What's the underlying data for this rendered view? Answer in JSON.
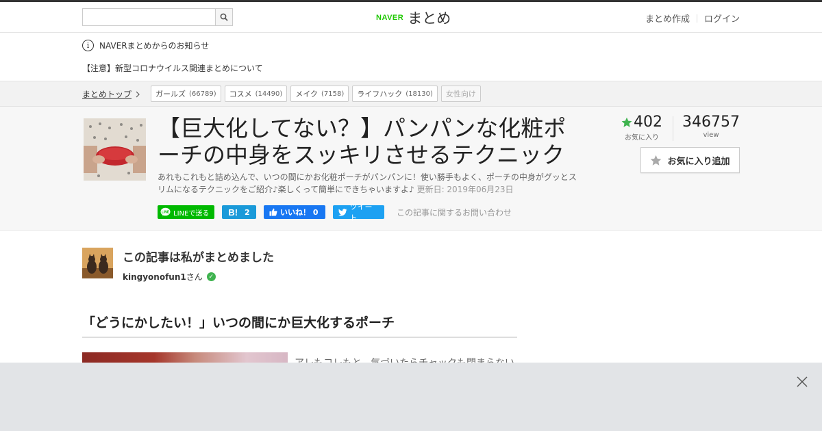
{
  "header": {
    "search": {
      "placeholder": "",
      "value": ""
    },
    "logo": {
      "naver": "NAVER",
      "matome": "まとめ"
    },
    "links": [
      "まとめ作成",
      "ログイン"
    ]
  },
  "notice": {
    "title": "NAVERまとめからのお知らせ",
    "link": "【注意】新型コロナウイルス関連まとめについて"
  },
  "category_bar": {
    "top_link": "まとめトップ",
    "tabs": [
      {
        "label": "ガールズ",
        "count": "(66789)",
        "enabled": true
      },
      {
        "label": "コスメ",
        "count": "(14490)",
        "enabled": true
      },
      {
        "label": "メイク",
        "count": "(7158)",
        "enabled": true
      },
      {
        "label": "ライフハック",
        "count": "(18130)",
        "enabled": true
      },
      {
        "label": "女性向け",
        "count": "",
        "enabled": false
      }
    ]
  },
  "article": {
    "title": "【巨大化してない？】パンパンな化粧ポーチの中身をスッキリさせるテクニック",
    "description": "あれもこれもと詰め込んで、いつの間にかお化粧ポーチがパンパンに！使い勝手もよく、ポーチの中身がグッとスリムになるテクニックをご紹介♪楽しくって簡単にできちゃいますよ♪",
    "updated": "更新日: 2019年06月23日",
    "share": {
      "line": "LINEで送る",
      "hatena_count": "2",
      "facebook": "いいね！ 0",
      "twitter": "ツイート",
      "contact": "この記事に関するお問い合わせ"
    },
    "stats": {
      "favorites": "402",
      "favorites_label": "お気に入り",
      "views": "346757",
      "views_label": "view"
    },
    "fav_button": "お気に入り追加"
  },
  "author": {
    "heading": "この記事は私がまとめました",
    "name": "kingyonofun1",
    "suffix": "さん"
  },
  "section": {
    "title": "「どうにかしたい！」いつの間にか巨大化するポーチ",
    "text": "アレもコレもと、気づいたらチャックも閉まらない"
  },
  "colors": {
    "naver_green": "#1ec800",
    "line_green": "#00b900",
    "hatena_blue": "#1a9ad9",
    "facebook_blue": "#1877f2",
    "twitter_blue": "#1da1f2",
    "star_green": "#3fb34f"
  }
}
